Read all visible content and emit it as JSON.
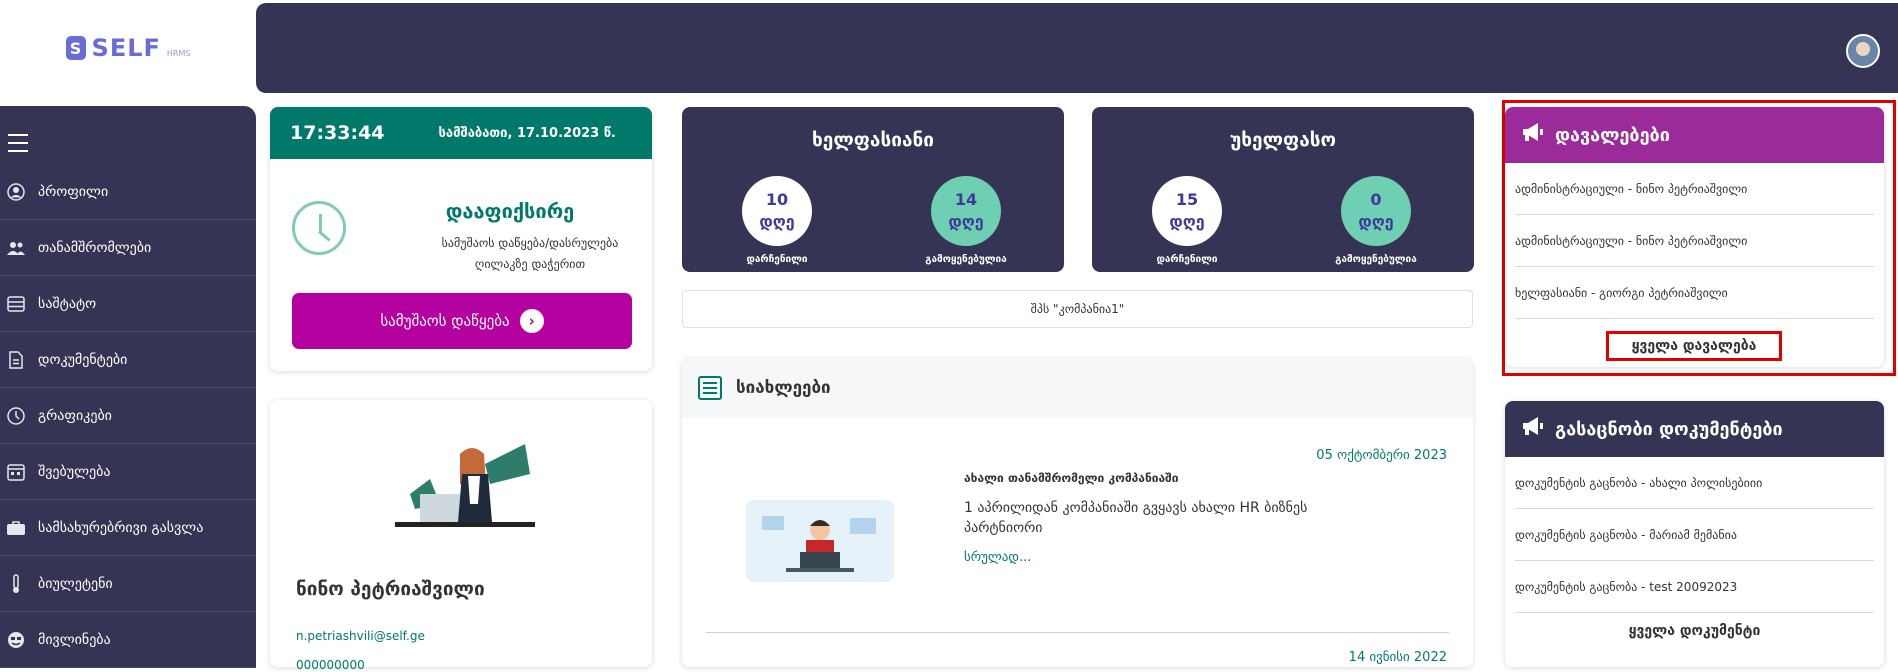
{
  "logo": {
    "mark": "S",
    "text": "SELF",
    "sub": "HRMS"
  },
  "colors": {
    "sidebar": "#363454",
    "accent_teal": "#00796b",
    "accent_magenta": "#b4009e",
    "tasks_header": "#9b2a9a",
    "circle_green": "#6fcfb3",
    "highlight": "#e00000"
  },
  "sidebar": {
    "items": [
      {
        "icon": "profile-icon",
        "label": "პროფილი"
      },
      {
        "icon": "users-icon",
        "label": "თანამშრომლები"
      },
      {
        "icon": "schedule-table-icon",
        "label": "საშტატო"
      },
      {
        "icon": "document-icon",
        "label": "დოკუმენტები"
      },
      {
        "icon": "clock-icon",
        "label": "გრაფიკები"
      },
      {
        "icon": "calendar-icon",
        "label": "შვებულება"
      },
      {
        "icon": "briefcase-icon",
        "label": "სამსახურებრივი გასვლა"
      },
      {
        "icon": "thermometer-icon",
        "label": "ბიულეტენი"
      },
      {
        "icon": "smiley-icon",
        "label": "მივლინება"
      }
    ]
  },
  "clock": {
    "time": "17:33:44",
    "date": "სამშაბათი, 17.10.2023 წ.",
    "fix_title": "დააფიქსირე",
    "fix_text": "სამუშაოს დაწყება/დასრულება ღილაკზე დაჭერით",
    "start_button": "სამუშაოს დაწყება"
  },
  "profile": {
    "name": "ნინო პეტრიაშვილი",
    "email": "n.petriashvili@self.ge",
    "phone": "000000000"
  },
  "paid_leave": {
    "title": "ხელფასიანი",
    "left_value": "10",
    "left_unit": "დღე",
    "left_label": "დარჩენილი",
    "right_value": "14",
    "right_unit": "დღე",
    "right_label": "გამოყენებულია"
  },
  "unpaid_leave": {
    "title": "უხელფასო",
    "left_value": "15",
    "left_unit": "დღე",
    "left_label": "დარჩენილი",
    "right_value": "0",
    "right_unit": "დღე",
    "right_label": "გამოყენებულია"
  },
  "company": "შპს \"კომპანია1\"",
  "news": {
    "title": "სიახლეები",
    "date": "05 ოქტომბერი 2023",
    "subtitle": "ახალი თანამშრომელი კომპანიაში",
    "body": "1 აპრილიდან კომპანიაში გვყავს ახალი HR ბიზნეს პარტნიორი",
    "more": "სრულად...",
    "date2": "14 ივნისი 2022"
  },
  "tasks": {
    "title": "დავალებები",
    "items": [
      "ადმინისტრაციული - ნინო პეტრიაშვილი",
      "ადმინისტრაციული - ნინო პეტრიაშვილი",
      "ხელფასიანი - გიორგი პეტრიაშვილი"
    ],
    "all": "ყველა დავალება"
  },
  "docs": {
    "title": "გასაცნობი დოკუმენტები",
    "items": [
      "დოკუმენტის გაცნობა - ახალი პოლისებიიი",
      "დოკუმენტის გაცნობა - მარიამ მემანია",
      "დოკუმენტის გაცნობა - test 20092023"
    ],
    "all": "ყველა დოკუმენტი"
  }
}
